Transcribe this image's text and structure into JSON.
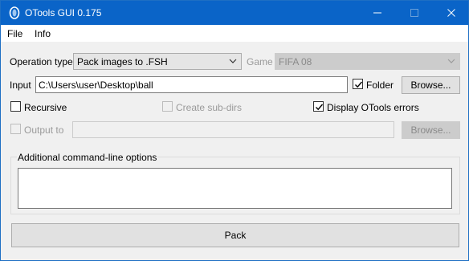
{
  "window": {
    "title": "OTools GUI 0.175",
    "accent_color": "#0a64c8"
  },
  "menu": {
    "items": [
      "File",
      "Info"
    ]
  },
  "operation": {
    "label": "Operation type",
    "value": "Pack images to .FSH"
  },
  "game": {
    "label": "Game",
    "value": "FIFA 08",
    "enabled": false
  },
  "input": {
    "label": "Input",
    "value": "C:\\Users\\user\\Desktop\\ball",
    "folder_label": "Folder",
    "folder_checked": true,
    "browse_label": "Browse..."
  },
  "options": {
    "recursive_label": "Recursive",
    "recursive_checked": false,
    "create_subdirs_label": "Create sub-dirs",
    "create_subdirs_checked": false,
    "create_subdirs_enabled": false,
    "display_errors_label": "Display OTools errors",
    "display_errors_checked": true
  },
  "output": {
    "label": "Output to",
    "checked": false,
    "enabled": false,
    "value": "",
    "browse_label": "Browse..."
  },
  "additional": {
    "title": "Additional command-line options",
    "value": ""
  },
  "actions": {
    "pack_label": "Pack"
  },
  "icons": [
    "app-icon",
    "minimize-icon",
    "maximize-icon",
    "close-icon",
    "chevron-down-icon",
    "checkmark-icon"
  ]
}
